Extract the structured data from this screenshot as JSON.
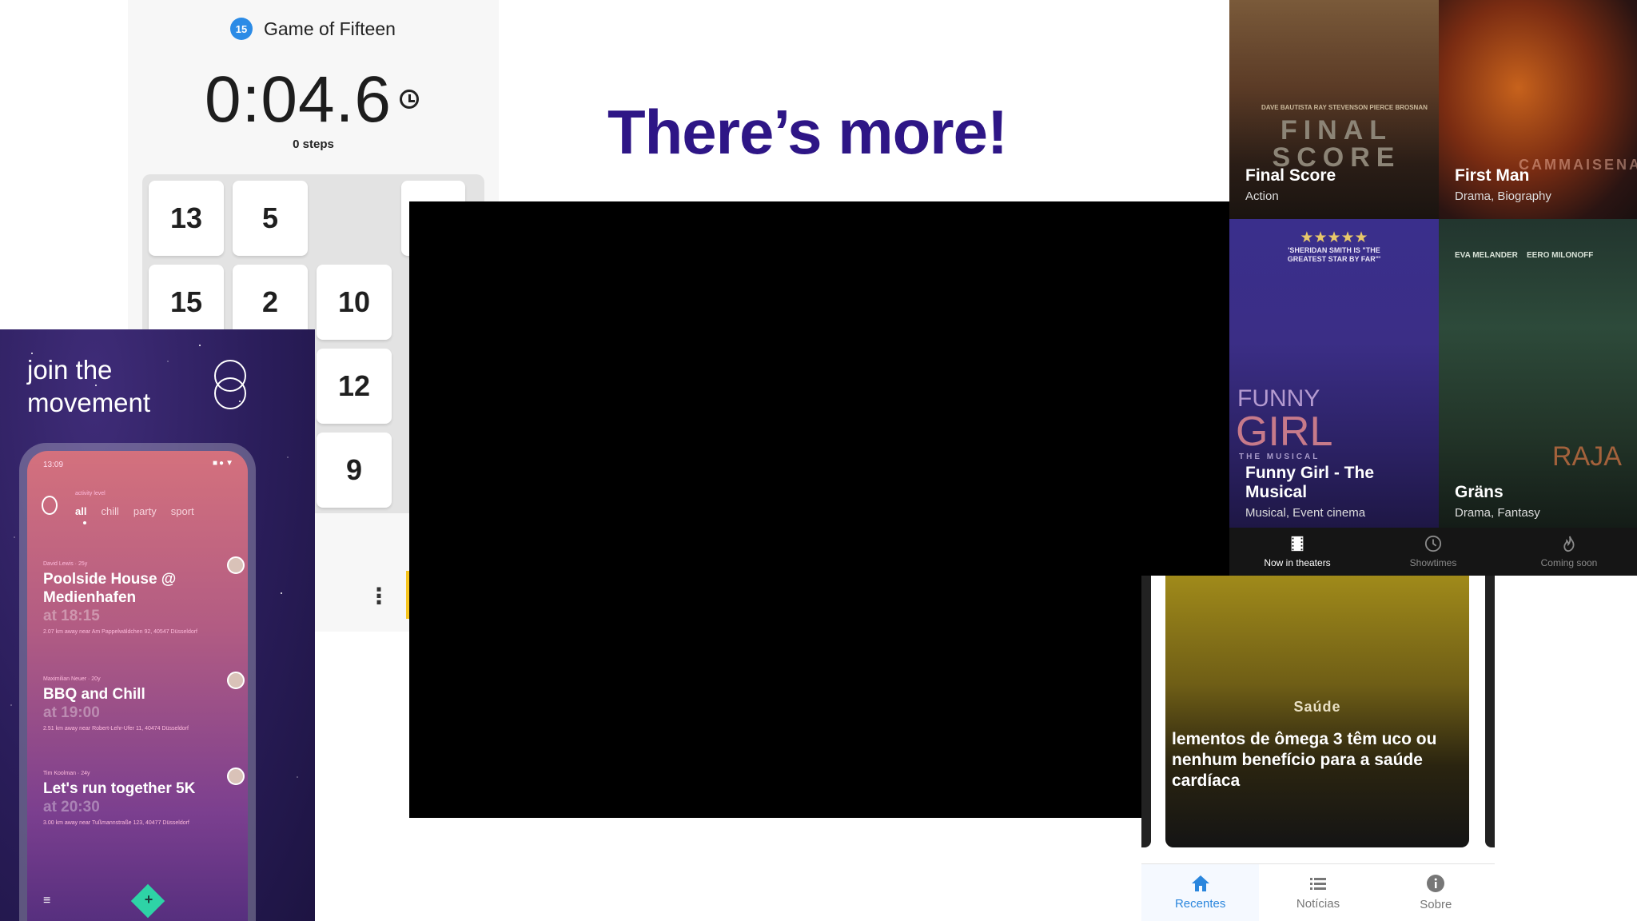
{
  "fifteen": {
    "badge": "15",
    "title": "Game of Fifteen",
    "timer": "0:04.6",
    "steps": "0 steps",
    "tiles": [
      "13",
      "5",
      "15",
      "2",
      "10",
      "12",
      "9"
    ],
    "menu": "⋮"
  },
  "movement": {
    "heading_line1": "join the",
    "heading_line2": "movement",
    "phone": {
      "time": "13:09",
      "status_icons": "■●▼",
      "activity_label": "activity level",
      "filters": [
        "all",
        "chill",
        "party",
        "sport"
      ],
      "events": [
        {
          "who": "David Lewis · 25y",
          "name": "Poolside House @ Medienhafen",
          "at": "at 18:15",
          "address": "2.07 km away near Am Pappelwäldchen 92, 40547 Düsseldorf"
        },
        {
          "who": "Maximilian Neuer · 20y",
          "name": "BBQ and Chill",
          "at": "at 19:00",
          "address": "2.51 km away near Robert-Lehr-Ufer 11, 40474 Düsseldorf"
        },
        {
          "who": "Tim Koolman · 24y",
          "name": "Let's run together 5K",
          "at": "at 20:30",
          "address": "3.00 km away near Tußmannstraße 123, 40477 Düsseldorf"
        }
      ],
      "add_symbol": "+",
      "menu_symbol": "≡"
    }
  },
  "more": {
    "text": "There’s more!"
  },
  "movies": {
    "posters": [
      {
        "title": "Final Score",
        "genre": "Action",
        "art": "FINAL SCORE",
        "credits": "DAVE BAUTISTA  RAY STEVENSON  PIERCE BROSNAN"
      },
      {
        "title": "First Man",
        "genre": "Drama, Biography",
        "art": "CAMMAISENA"
      },
      {
        "title": "Funny Girl - The Musical",
        "genre": "Musical, Event cinema",
        "art1": "FUNNY",
        "art2": "GIRL",
        "art3": "THE MUSICAL",
        "stars": "★★★★★",
        "quote": "'SHERIDAN SMITH IS \"THE GREATEST STAR BY FAR\"'"
      },
      {
        "title": "Gräns",
        "genre": "Drama, Fantasy",
        "art": "RAJA",
        "credits": "EVA MELANDER    EERO MILONOFF"
      }
    ],
    "tabs": [
      "Now in theaters",
      "Showtimes",
      "Coming soon"
    ]
  },
  "news": {
    "category": "Saúde",
    "headline": "lementos de ômega 3 têm uco ou nenhum benefício para a saúde cardíaca",
    "nav": [
      "Recentes",
      "Notícias",
      "Sobre"
    ]
  },
  "colors": {
    "accent_blue": "#2b8be6",
    "more_purple": "#2e1686",
    "fab_yellow": "#f7c51e",
    "teal": "#2ed3a6"
  }
}
